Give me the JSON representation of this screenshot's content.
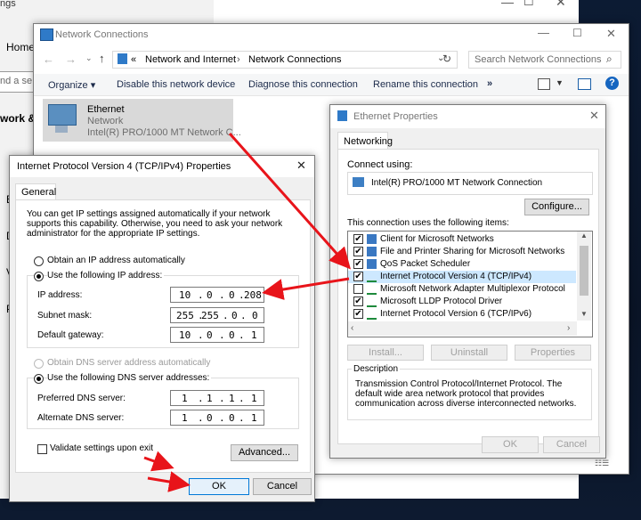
{
  "settings": {
    "title_partial": "ngs",
    "home": "Home",
    "search_partial": "nd a se",
    "section_partial": "work &",
    "letters": [
      "E",
      "D",
      "V",
      "P"
    ]
  },
  "netconn": {
    "title": "Network Connections",
    "breadcrumb": [
      "«",
      "Network and Internet",
      "Network Connections"
    ],
    "search_placeholder": "Search Network Connections",
    "toolbar": [
      "Organize ▾",
      "Disable this network device",
      "Diagnose this connection",
      "Rename this connection",
      "»"
    ],
    "adapter": {
      "name": "Ethernet",
      "network": "Network",
      "device": "Intel(R) PRO/1000 MT Network C..."
    }
  },
  "ethprops": {
    "title": "Ethernet Properties",
    "tab": "Networking",
    "connect_using_label": "Connect using:",
    "adapter": "Intel(R) PRO/1000 MT Network Connection",
    "configure": "Configure...",
    "items_label": "This connection uses the following items:",
    "items": [
      {
        "label": "Client for Microsoft Networks",
        "checked": true
      },
      {
        "label": "File and Printer Sharing for Microsoft Networks",
        "checked": true
      },
      {
        "label": "QoS Packet Scheduler",
        "checked": true
      },
      {
        "label": "Internet Protocol Version 4 (TCP/IPv4)",
        "checked": true
      },
      {
        "label": "Microsoft Network Adapter Multiplexor Protocol",
        "checked": false
      },
      {
        "label": "Microsoft LLDP Protocol Driver",
        "checked": true
      },
      {
        "label": "Internet Protocol Version 6 (TCP/IPv6)",
        "checked": true
      }
    ],
    "install": "Install...",
    "uninstall": "Uninstall",
    "properties": "Properties",
    "description_label": "Description",
    "description": "Transmission Control Protocol/Internet Protocol. The default wide area network protocol that provides communication across diverse interconnected networks.",
    "ok": "OK",
    "cancel": "Cancel"
  },
  "ipv4": {
    "title": "Internet Protocol Version 4 (TCP/IPv4) Properties",
    "tab": "General",
    "intro": "You can get IP settings assigned automatically if your network supports this capability. Otherwise, you need to ask your network administrator for the appropriate IP settings.",
    "obtain_auto": "Obtain an IP address automatically",
    "use_following": "Use the following IP address:",
    "ip_label": "IP address:",
    "ip": [
      "10",
      "0",
      "0",
      "208"
    ],
    "mask_label": "Subnet mask:",
    "mask": [
      "255",
      "255",
      "0",
      "0"
    ],
    "gw_label": "Default gateway:",
    "gw": [
      "10",
      "0",
      "0",
      "1"
    ],
    "dns_auto": "Obtain DNS server address automatically",
    "dns_following": "Use the following DNS server addresses:",
    "pref_label": "Preferred DNS server:",
    "pref": [
      "1",
      "1",
      "1",
      "1"
    ],
    "alt_label": "Alternate DNS server:",
    "alt": [
      "1",
      "0",
      "0",
      "1"
    ],
    "validate": "Validate settings upon exit",
    "advanced": "Advanced...",
    "ok": "OK",
    "cancel": "Cancel"
  },
  "colors": {
    "accent": "#0078d7",
    "arrow": "#e8141a",
    "selection": "#cde8ff"
  }
}
